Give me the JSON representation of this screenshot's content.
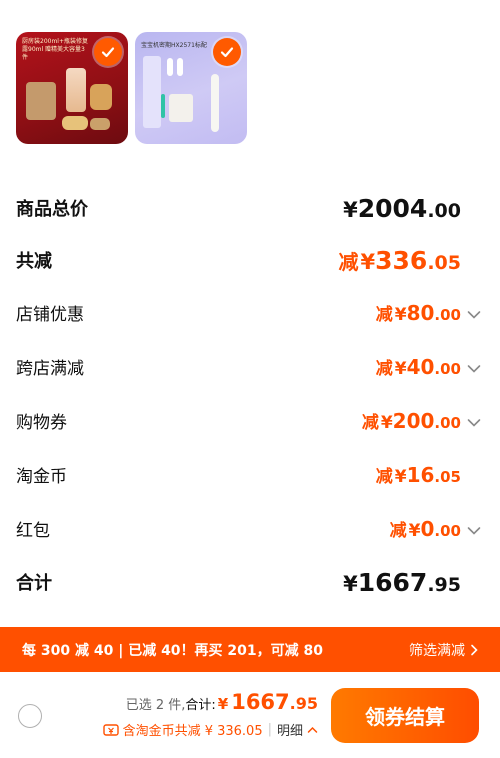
{
  "products": [
    {
      "caption": "厨房装200ml+瓶装修复露90ml 赠精美大容量3件",
      "selected": true
    },
    {
      "caption": "宝宝机密期HX2571标配",
      "selected": true
    }
  ],
  "summary": {
    "total_label": "商品总价",
    "total_yen": "¥",
    "total_int": "2004",
    "total_dec": ".00",
    "discount_label": "共减",
    "discount_prefix": "减",
    "discount_yen": "¥",
    "discount_int": "336",
    "discount_dec": ".05",
    "items": [
      {
        "label": "店铺优惠",
        "prefix": "减",
        "yen": "¥",
        "int": "80",
        "dec": ".00",
        "expandable": true
      },
      {
        "label": "跨店满减",
        "prefix": "减",
        "yen": "¥",
        "int": "40",
        "dec": ".00",
        "expandable": true
      },
      {
        "label": "购物券",
        "prefix": "减",
        "yen": "¥",
        "int": "200",
        "dec": ".00",
        "expandable": true
      },
      {
        "label": "淘金币",
        "prefix": "减",
        "yen": "¥",
        "int": "16",
        "dec": ".05",
        "expandable": false
      },
      {
        "label": "红包",
        "prefix": "减",
        "yen": "¥",
        "int": "0",
        "dec": ".00",
        "expandable": true
      }
    ],
    "sum_label": "合计",
    "sum_yen": "¥",
    "sum_int": "1667",
    "sum_dec": ".95"
  },
  "promo": {
    "text": "每 300 减 40 | 已减 40！再买 201，可减 80",
    "link": "筛选满减"
  },
  "checkout": {
    "selected_count": "已选 2 件,",
    "total_label": "合计:",
    "total_yen": "¥",
    "total_int": "1667",
    "total_dec": ".95",
    "detail_text": "含淘金币共减 ¥ 336.05",
    "detail_sep": "|",
    "detail_toggle": "明细",
    "button_label": "领券结算"
  },
  "colors": {
    "accent": "#ff5000",
    "text": "#111111",
    "muted": "#666666"
  }
}
